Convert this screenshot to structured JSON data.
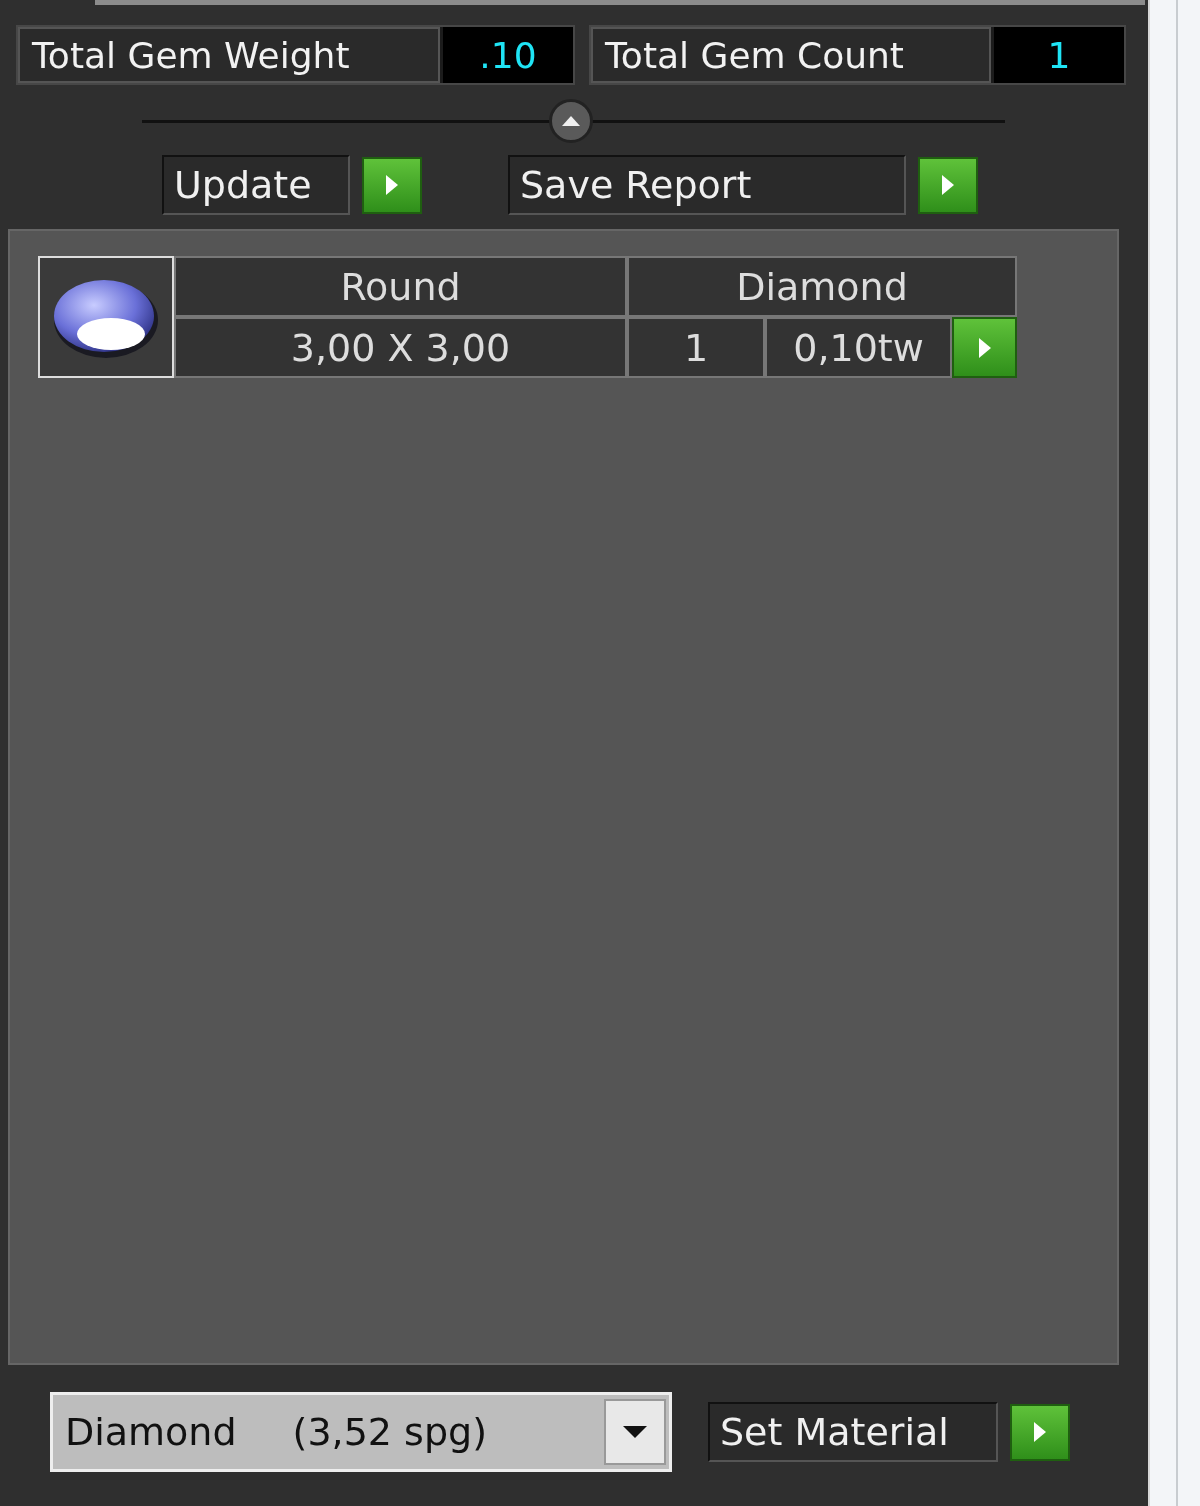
{
  "summary": [
    {
      "label": "Total Gem Weight",
      "value": ".10"
    },
    {
      "label": "Total Gem Count",
      "value": "1"
    }
  ],
  "actions": [
    {
      "label": "Update"
    },
    {
      "label": "Save Report"
    }
  ],
  "gems": [
    {
      "shape": "Round",
      "material": "Diamond",
      "size": "3,00 X 3,00",
      "count": "1",
      "weight": "0,10tw"
    }
  ],
  "material_select": {
    "name": "Diamond",
    "density": "(3,52 spg)"
  },
  "set_button": {
    "label": "Set Material"
  }
}
